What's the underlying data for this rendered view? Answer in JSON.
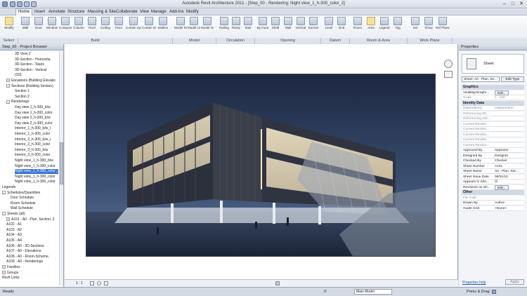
{
  "window": {
    "title": "Autodesk Revit Architecture 2011 - [Step_00 - Rendering: Night view_1_h-300_color_2]",
    "controls": [
      "–",
      "□",
      "✕"
    ]
  },
  "menu": {
    "tabs": [
      "Home",
      "Insert",
      "Annotate",
      "Structure",
      "Massing & Site",
      "Collaborate",
      "View",
      "Manage",
      "Add-Ins",
      "Modify"
    ],
    "active": "Home"
  },
  "ribbon": {
    "buttons": [
      "Modify",
      "Wall",
      "Door",
      "Window",
      "Component",
      "Column",
      "Roof",
      "Ceiling",
      "Floor",
      "Curtain System",
      "Curtain Grid",
      "Mullion",
      "Model Text",
      "Model Line",
      "Model Group",
      "Railing",
      "Ramp",
      "Stair",
      "By Face",
      "Shaft",
      "Wall",
      "Vertical",
      "Dormer",
      "Level",
      "Grid",
      "Room",
      "Area",
      "Legend",
      "Tag",
      "Set",
      "Show",
      "Ref Plane"
    ],
    "panels": [
      "Select",
      "Build",
      "Model",
      "Circulation",
      "Opening",
      "Datum",
      "Room & Area",
      "Work Plane"
    ]
  },
  "project_browser": {
    "title": "Step_00 - Project Browser",
    "items": [
      {
        "label": "3D View 2",
        "indent": 3,
        "toggle": ""
      },
      {
        "label": "3D-Section - Horizonta",
        "indent": 3,
        "toggle": ""
      },
      {
        "label": "3D-Section - Stairs",
        "indent": 3,
        "toggle": ""
      },
      {
        "label": "3D-Section - Vertical",
        "indent": 3,
        "toggle": ""
      },
      {
        "label": "{3D}",
        "indent": 3,
        "toggle": ""
      },
      {
        "label": "Elevations (Building Elevatio",
        "indent": 1,
        "toggle": "+"
      },
      {
        "label": "Sections (Building Section)",
        "indent": 1,
        "toggle": "-"
      },
      {
        "label": "Section 1",
        "indent": 3,
        "toggle": ""
      },
      {
        "label": "Section 2",
        "indent": 3,
        "toggle": ""
      },
      {
        "label": "Renderings",
        "indent": 1,
        "toggle": "-"
      },
      {
        "label": "Day view 1_h-300_b/w",
        "indent": 3,
        "toggle": ""
      },
      {
        "label": "Day view 1_h-300_color",
        "indent": 3,
        "toggle": ""
      },
      {
        "label": "Day view 2_h-300_b/w",
        "indent": 3,
        "toggle": ""
      },
      {
        "label": "Day view 2_h-300_color",
        "indent": 3,
        "toggle": ""
      },
      {
        "label": "Interior_1_h-300_b/w_i",
        "indent": 3,
        "toggle": ""
      },
      {
        "label": "Interior_1_h-300_color",
        "indent": 3,
        "toggle": ""
      },
      {
        "label": "Interior_2_h-300_b/w_i",
        "indent": 3,
        "toggle": ""
      },
      {
        "label": "Interior_2_h-300_color",
        "indent": 3,
        "toggle": ""
      },
      {
        "label": "Interior_3_h-300_b/w",
        "indent": 3,
        "toggle": ""
      },
      {
        "label": "Interior_3_h-300_color",
        "indent": 3,
        "toggle": ""
      },
      {
        "label": "Night view_1_h-300_b/w",
        "indent": 3,
        "toggle": ""
      },
      {
        "label": "Night view_1_h-300_color",
        "indent": 3,
        "toggle": ""
      },
      {
        "label": "Night view_1_h-300_color_2",
        "indent": 3,
        "toggle": "",
        "selected": true
      },
      {
        "label": "Night view_1_h-300_color",
        "indent": 3,
        "toggle": ""
      },
      {
        "label": "Night view_1_h-300_color",
        "indent": 3,
        "toggle": ""
      },
      {
        "label": "Legends",
        "indent": 0,
        "toggle": ""
      },
      {
        "label": "Schedules/Quantities",
        "indent": 0,
        "toggle": "-"
      },
      {
        "label": "Door Schedule",
        "indent": 2,
        "toggle": ""
      },
      {
        "label": "Room Schedule",
        "indent": 2,
        "toggle": ""
      },
      {
        "label": "Wall Schedule",
        "indent": 2,
        "toggle": ""
      },
      {
        "label": "Sheets (all)",
        "indent": 0,
        "toggle": "-"
      },
      {
        "label": "A101 - A0 - Plan, Section, 3",
        "indent": 1,
        "toggle": "+"
      },
      {
        "label": "A102 - A1",
        "indent": 1,
        "toggle": ""
      },
      {
        "label": "A103 - A2",
        "indent": 1,
        "toggle": ""
      },
      {
        "label": "A104 - A3",
        "indent": 1,
        "toggle": ""
      },
      {
        "label": "A105 - A4",
        "indent": 1,
        "toggle": ""
      },
      {
        "label": "A106 - A0 - 3D-Sections",
        "indent": 1,
        "toggle": ""
      },
      {
        "label": "A107 - A0 - Elevations",
        "indent": 1,
        "toggle": ""
      },
      {
        "label": "A108 - A0 - Room-Scheme,",
        "indent": 1,
        "toggle": ""
      },
      {
        "label": "A109 - A0 - Renderings",
        "indent": 1,
        "toggle": ""
      },
      {
        "label": "Families",
        "indent": 0,
        "toggle": "+"
      },
      {
        "label": "Groups",
        "indent": 0,
        "toggle": "+"
      },
      {
        "label": "Revit Links",
        "indent": 0,
        "toggle": ""
      }
    ]
  },
  "view_control": {
    "scale": "1 : 1"
  },
  "properties": {
    "title": "Properties",
    "type_name": "Sheet",
    "selector": "Sheet: A0 - Plan, Se...",
    "edit_type": "Edit Type",
    "sections": [
      {
        "name": "Graphics",
        "rows": [
          {
            "k": "Visibility/Graphi...",
            "v": "Edit...",
            "btn": true
          },
          {
            "k": "Scale",
            "v": "1 : 100",
            "grey": true
          }
        ]
      },
      {
        "name": "Identity Data",
        "rows": [
          {
            "k": "Dependency",
            "v": "Independent",
            "grey": true
          },
          {
            "k": "Referencing Sh...",
            "v": "",
            "grey": true
          },
          {
            "k": "Referencing Det...",
            "v": "",
            "grey": true
          },
          {
            "k": "Current Revisio...",
            "v": "",
            "grey": true
          },
          {
            "k": "Current Revisio...",
            "v": "",
            "grey": true
          },
          {
            "k": "Current Revisio...",
            "v": "",
            "grey": true
          },
          {
            "k": "Current Revisio...",
            "v": "",
            "grey": true
          },
          {
            "k": "Current Revisio...",
            "v": "",
            "grey": true
          },
          {
            "k": "Approved By",
            "v": "Approver"
          },
          {
            "k": "Designed By",
            "v": "Designer"
          },
          {
            "k": "Checked By",
            "v": "Checker"
          },
          {
            "k": "Sheet Number",
            "v": "A101"
          },
          {
            "k": "Sheet Name",
            "v": "A0 - Plan, Sec..."
          },
          {
            "k": "Sheet Issue Date",
            "v": "08/31/10"
          },
          {
            "k": "Appears In She...",
            "v": "☑"
          },
          {
            "k": "Revisions on Sh...",
            "v": "Edit...",
            "btn": true
          }
        ]
      },
      {
        "name": "Other",
        "rows": [
          {
            "k": "File Path",
            "v": "",
            "grey": true
          },
          {
            "k": "Drawn By",
            "v": "Author"
          },
          {
            "k": "Guide Grid",
            "v": "<None>"
          }
        ]
      }
    ],
    "help_link": "Properties help",
    "apply": "Apply"
  },
  "status": {
    "text": "Ready",
    "coord": ":0",
    "model": "Main Model",
    "press_drag": "Press & Drag"
  },
  "colors": {
    "selection": "#3875d7",
    "sky_top": "#1c2740",
    "sky_bottom": "#4c6384"
  }
}
